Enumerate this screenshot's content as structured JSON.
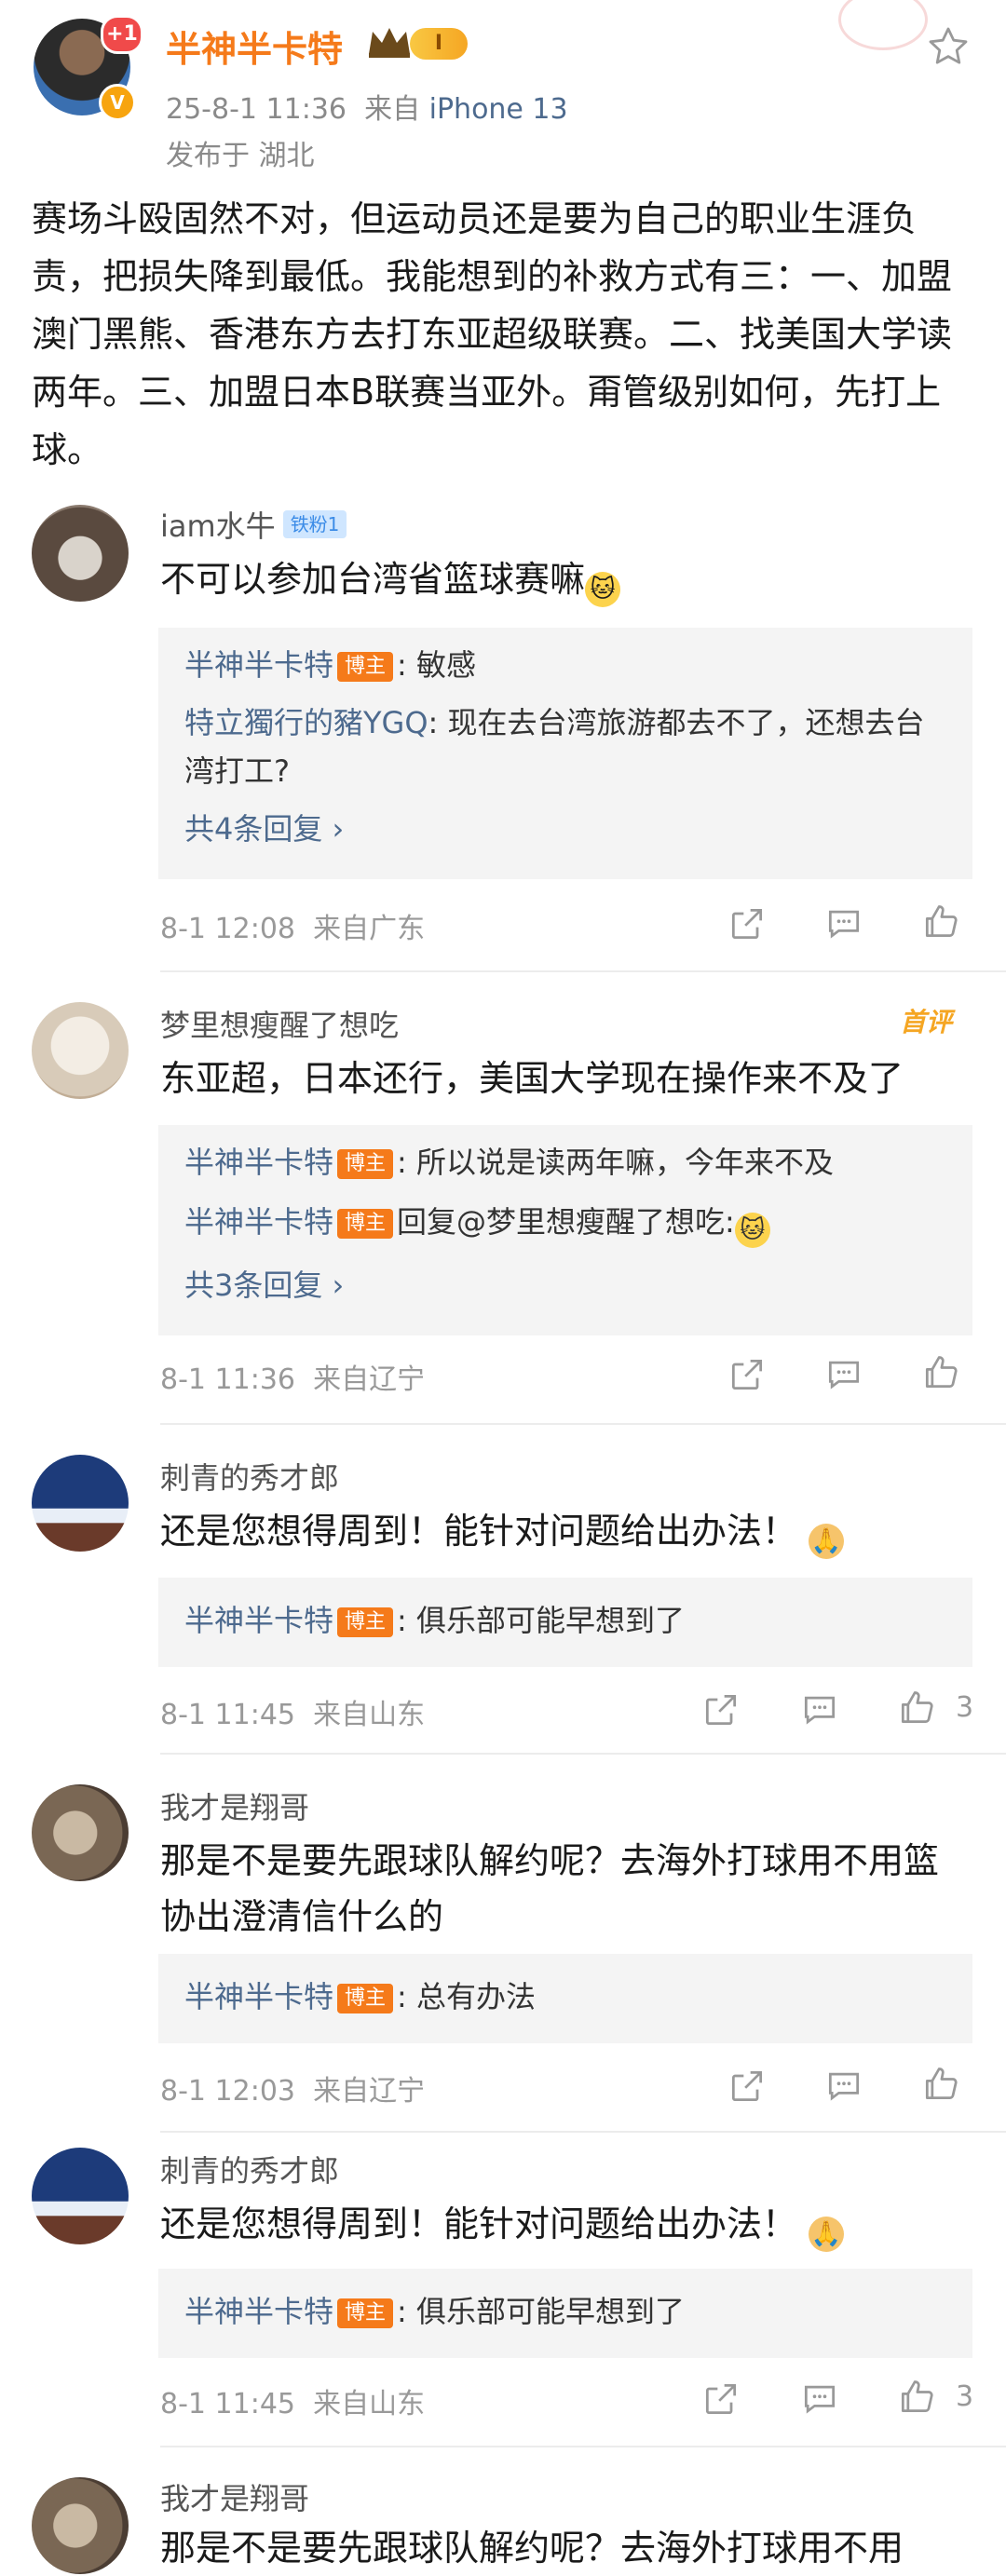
{
  "post": {
    "author": "半神半卡特",
    "plus_badge": "+1",
    "level_badge": "I",
    "verified_mark": "V",
    "meta_time": "25-8-1 11:36",
    "meta_from": "来自",
    "meta_device": "iPhone 13",
    "location": "发布于 湖北",
    "body": "赛场斗殴固然不对，但运动员还是要为自己的职业生涯负责，把损失降到最低。我能想到的补救方式有三：一、加盟澳门黑熊、香港东方去打东亚超级联赛。二、找美国大学读两年。三、加盟日本B联赛当亚外。甭管级别如何，先打上球。"
  },
  "comments": [
    {
      "name": "iam水牛",
      "badge": "铁粉1",
      "text": "不可以参加台湾省篮球赛嘛",
      "emoji": "🐱",
      "replies": [
        {
          "name": "半神半卡特",
          "host": "博主",
          "text": ": 敏感"
        },
        {
          "name": "特立獨行的豬YGQ",
          "text": ": 现在去台湾旅游都去不了，还想去台湾打工?"
        }
      ],
      "more": "共4条回复 ›",
      "time": "8-1 12:08",
      "loc": "来自广东",
      "likes": ""
    },
    {
      "name": "梦里想瘦醒了想吃",
      "first_badge": "首评",
      "text": "东亚超，日本还行，美国大学现在操作来不及了",
      "replies": [
        {
          "name": "半神半卡特",
          "host": "博主",
          "text": ": 所以说是读两年嘛，今年来不及"
        },
        {
          "name": "半神半卡特",
          "host": "博主",
          "text": "回复@梦里想瘦醒了想吃:",
          "emoji": "🐱"
        }
      ],
      "more": "共3条回复 ›",
      "time": "8-1 11:36",
      "loc": "来自辽宁",
      "likes": ""
    },
    {
      "name": "刺青的秀才郎",
      "text": "还是您想得周到！能针对问题给出办法！",
      "emoji": "🙏",
      "replies": [
        {
          "name": "半神半卡特",
          "host": "博主",
          "text": ": 俱乐部可能早想到了"
        }
      ],
      "time": "8-1 11:45",
      "loc": "来自山东",
      "likes": "3"
    },
    {
      "name": "我才是翔哥",
      "text": "那是不是要先跟球队解约呢？去海外打球用不用篮协出澄清信什么的",
      "replies": [
        {
          "name": "半神半卡特",
          "host": "博主",
          "text": ": 总有办法"
        }
      ],
      "time": "8-1 12:03",
      "loc": "来自辽宁",
      "likes": ""
    },
    {
      "name": "刺青的秀才郎",
      "text": "还是您想得周到！能针对问题给出办法！",
      "emoji": "🙏",
      "replies": [
        {
          "name": "半神半卡特",
          "host": "博主",
          "text": ": 俱乐部可能早想到了"
        }
      ],
      "time": "8-1 11:45",
      "loc": "来自山东",
      "likes": "3"
    },
    {
      "name": "我才是翔哥",
      "text": "那是不是要先跟球队解约呢？去海外打球用不用"
    }
  ]
}
